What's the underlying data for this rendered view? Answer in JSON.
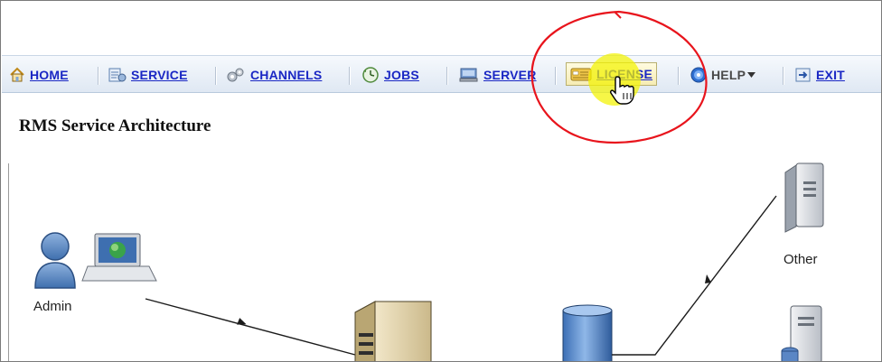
{
  "nav": {
    "home": "HOME",
    "service": "SERVICE",
    "channels": "CHANNELS",
    "jobs": "JOBS",
    "server": "SERVER",
    "license": "LICENSE",
    "help": "HELP",
    "exit": "EXIT"
  },
  "page": {
    "title": "RMS Service Architecture"
  },
  "diagram": {
    "admin_label": "Admin",
    "other_label": "Other"
  },
  "colors": {
    "link": "#1a27c4",
    "annotation_red": "#e8141c",
    "highlight_yellow": "#f2f200"
  },
  "icons": [
    "home-icon",
    "service-icon",
    "channels-icon",
    "jobs-icon",
    "server-icon",
    "license-icon",
    "hand-cursor-icon",
    "help-icon",
    "dropdown-arrow-icon",
    "exit-icon",
    "admin-user-icon",
    "laptop-icon",
    "server-tower-icon",
    "database-cylinder-icon"
  ]
}
